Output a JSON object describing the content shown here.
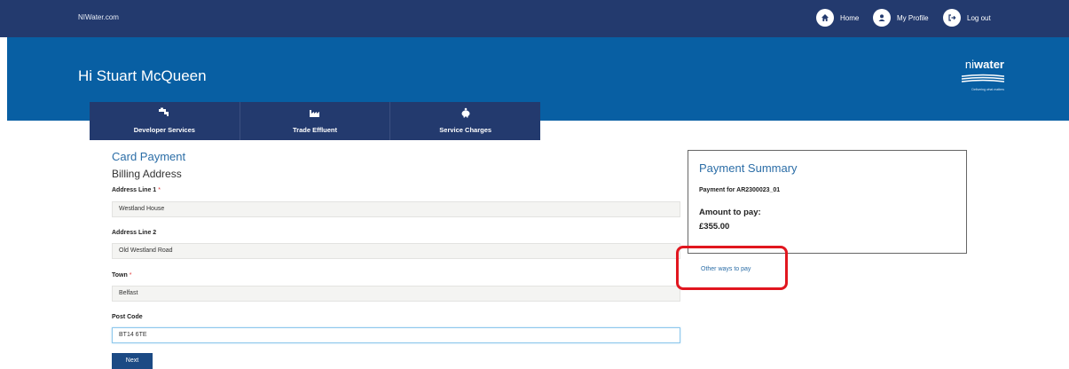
{
  "topbar": {
    "site_name": "NIWater.com",
    "nav": [
      {
        "label": "Home",
        "icon": "home-icon"
      },
      {
        "label": "My Profile",
        "icon": "user-icon"
      },
      {
        "label": "Log out",
        "icon": "logout-icon"
      }
    ]
  },
  "banner": {
    "greeting": "Hi Stuart McQueen",
    "logo": {
      "text_ni": "ni",
      "text_water": "water",
      "tagline": "Delivering what matters"
    }
  },
  "tabs": [
    {
      "label": "Developer Services",
      "icon": "tap-icon"
    },
    {
      "label": "Trade Effluent",
      "icon": "factory-icon"
    },
    {
      "label": "Service Charges",
      "icon": "piggy-bank-icon"
    }
  ],
  "form": {
    "title": "Card Payment",
    "subtitle": "Billing Address",
    "required_marker": "*",
    "fields": [
      {
        "label": "Address Line 1",
        "value": "Westland House",
        "required": true
      },
      {
        "label": "Address Line 2",
        "value": "Old Westland Road",
        "required": false
      },
      {
        "label": "Town",
        "value": "Belfast",
        "required": true
      },
      {
        "label": "Post Code",
        "value": "BT14 6TE",
        "required": false
      }
    ],
    "next_label": "Next"
  },
  "summary": {
    "title": "Payment Summary",
    "payment_for": "Payment for AR2300023_01",
    "amount_label": "Amount to pay:",
    "amount": "£355.00"
  },
  "other_ways": "Other ways to pay",
  "colors": {
    "topbar": "#233a6e",
    "banner": "#085fa3",
    "accent_text": "#2c6ea7",
    "highlight": "#e1161f"
  }
}
